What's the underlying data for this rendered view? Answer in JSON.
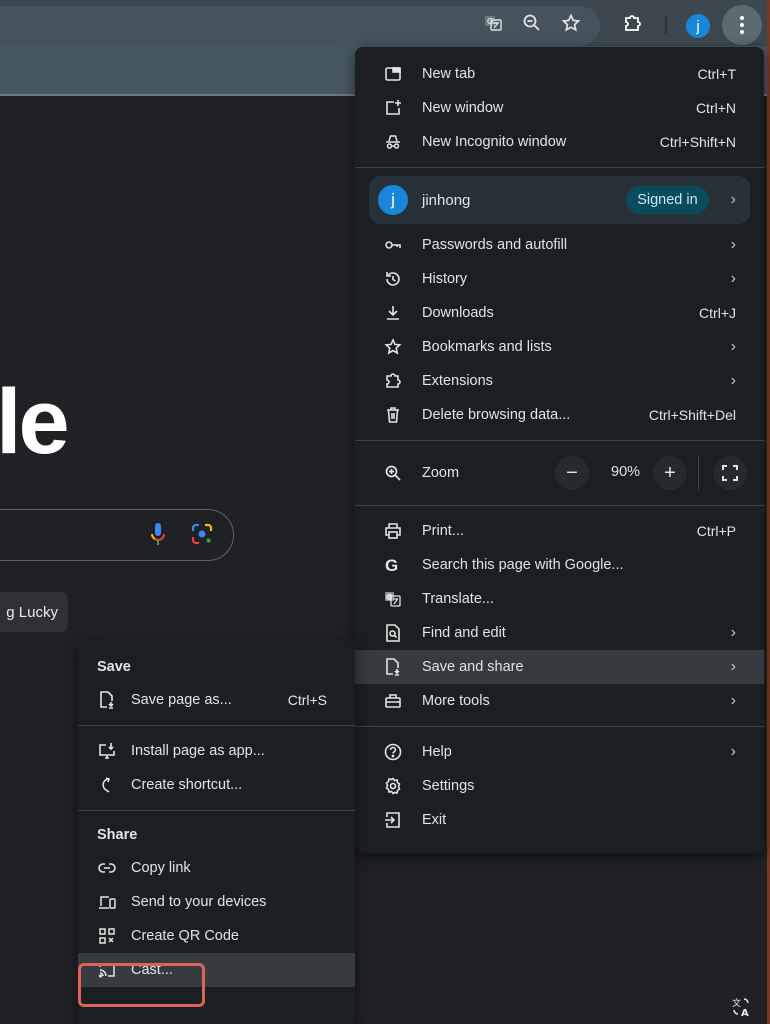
{
  "toolbar": {
    "icons": [
      "translate-icon",
      "zoom-icon",
      "bookmark-star-icon",
      "extensions-icon"
    ],
    "profile_initial": "j",
    "menu_icon": "kebab-menu-icon"
  },
  "page": {
    "logo_fragment": "le",
    "lucky_button": "g Lucky",
    "translate_fab_icon": "translate-icon"
  },
  "main_menu": {
    "new_tab": {
      "label": "New tab",
      "shortcut": "Ctrl+T",
      "icon": "new-tab-icon"
    },
    "new_window": {
      "label": "New window",
      "shortcut": "Ctrl+N",
      "icon": "new-window-icon"
    },
    "new_incognito": {
      "label": "New Incognito window",
      "shortcut": "Ctrl+Shift+N",
      "icon": "incognito-icon"
    },
    "profile": {
      "initial": "j",
      "name": "jinhong",
      "badge": "Signed in"
    },
    "passwords": {
      "label": "Passwords and autofill",
      "icon": "key-icon"
    },
    "history": {
      "label": "History",
      "icon": "history-icon"
    },
    "downloads": {
      "label": "Downloads",
      "shortcut": "Ctrl+J",
      "icon": "download-icon"
    },
    "bookmarks": {
      "label": "Bookmarks and lists",
      "icon": "star-icon"
    },
    "extensions": {
      "label": "Extensions",
      "icon": "puzzle-icon"
    },
    "delete_data": {
      "label": "Delete browsing data...",
      "shortcut": "Ctrl+Shift+Del",
      "icon": "trash-icon"
    },
    "zoom": {
      "label": "Zoom",
      "value": "90%",
      "minus": "−",
      "plus": "+",
      "icon": "zoom-in-icon"
    },
    "print": {
      "label": "Print...",
      "shortcut": "Ctrl+P",
      "icon": "printer-icon"
    },
    "search_google": {
      "label": "Search this page with Google...",
      "icon": "google-g-icon"
    },
    "translate": {
      "label": "Translate...",
      "icon": "translate-icon"
    },
    "find_edit": {
      "label": "Find and edit",
      "icon": "find-page-icon"
    },
    "save_share": {
      "label": "Save and share",
      "icon": "save-file-icon"
    },
    "more_tools": {
      "label": "More tools",
      "icon": "toolbox-icon"
    },
    "help": {
      "label": "Help",
      "icon": "help-icon"
    },
    "settings": {
      "label": "Settings",
      "icon": "gear-icon"
    },
    "exit": {
      "label": "Exit",
      "icon": "exit-icon"
    },
    "chevron": "›"
  },
  "sub_menu": {
    "save_title": "Save",
    "save_page": {
      "label": "Save page as...",
      "shortcut": "Ctrl+S",
      "icon": "save-file-icon"
    },
    "install_app": {
      "label": "Install page as app...",
      "icon": "install-app-icon"
    },
    "create_shortcut": {
      "label": "Create shortcut...",
      "icon": "shortcut-icon"
    },
    "share_title": "Share",
    "copy_link": {
      "label": "Copy link",
      "icon": "link-icon"
    },
    "send_devices": {
      "label": "Send to your devices",
      "icon": "devices-icon"
    },
    "qr_code": {
      "label": "Create QR Code",
      "icon": "qr-code-icon"
    },
    "cast": {
      "label": "Cast...",
      "icon": "cast-icon"
    }
  },
  "colors": {
    "menu_bg": "#1c1f22",
    "highlight": "#363b3f",
    "accent_avatar": "#1a86d9",
    "signed_badge": "#0b4c5c",
    "annotation_box": "#e0605a"
  }
}
